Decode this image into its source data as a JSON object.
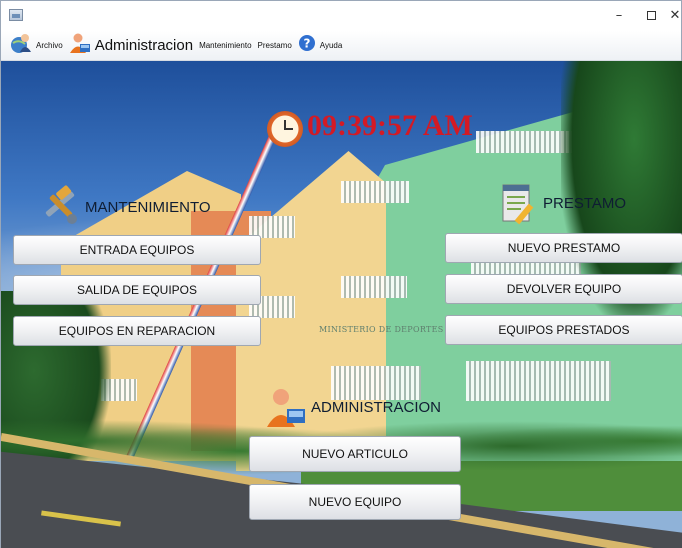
{
  "menubar": {
    "items": [
      {
        "label": "Archivo",
        "icon": "user-globe-icon"
      },
      {
        "label": "Administracion",
        "icon": "admin-user-icon"
      },
      {
        "label": "Mantenimiento"
      },
      {
        "label": "Prestamo"
      },
      {
        "label": "Ayuda",
        "icon": "help-icon"
      }
    ]
  },
  "clock": {
    "time": "09:39:57 AM",
    "color": "#d31a25"
  },
  "background": {
    "ministry_text": "MINISTERIO DE DEPORTES Y RECR"
  },
  "mantenimiento": {
    "title": "MANTENIMIENTO",
    "icon": "tools-icon",
    "buttons": [
      "ENTRADA EQUIPOS",
      "SALIDA DE EQUIPOS",
      "EQUIPOS EN REPARACION"
    ]
  },
  "prestamo": {
    "title": "PRESTAMO",
    "icon": "document-pencil-icon",
    "buttons": [
      "NUEVO PRESTAMO",
      "DEVOLVER EQUIPO",
      "EQUIPOS PRESTADOS"
    ]
  },
  "administracion": {
    "title": "ADMINISTRACION",
    "icon": "admin-user-icon",
    "buttons": [
      "NUEVO ARTICULO",
      "NUEVO EQUIPO"
    ]
  },
  "window_controls": {
    "minimize": "–",
    "close": "✕"
  }
}
